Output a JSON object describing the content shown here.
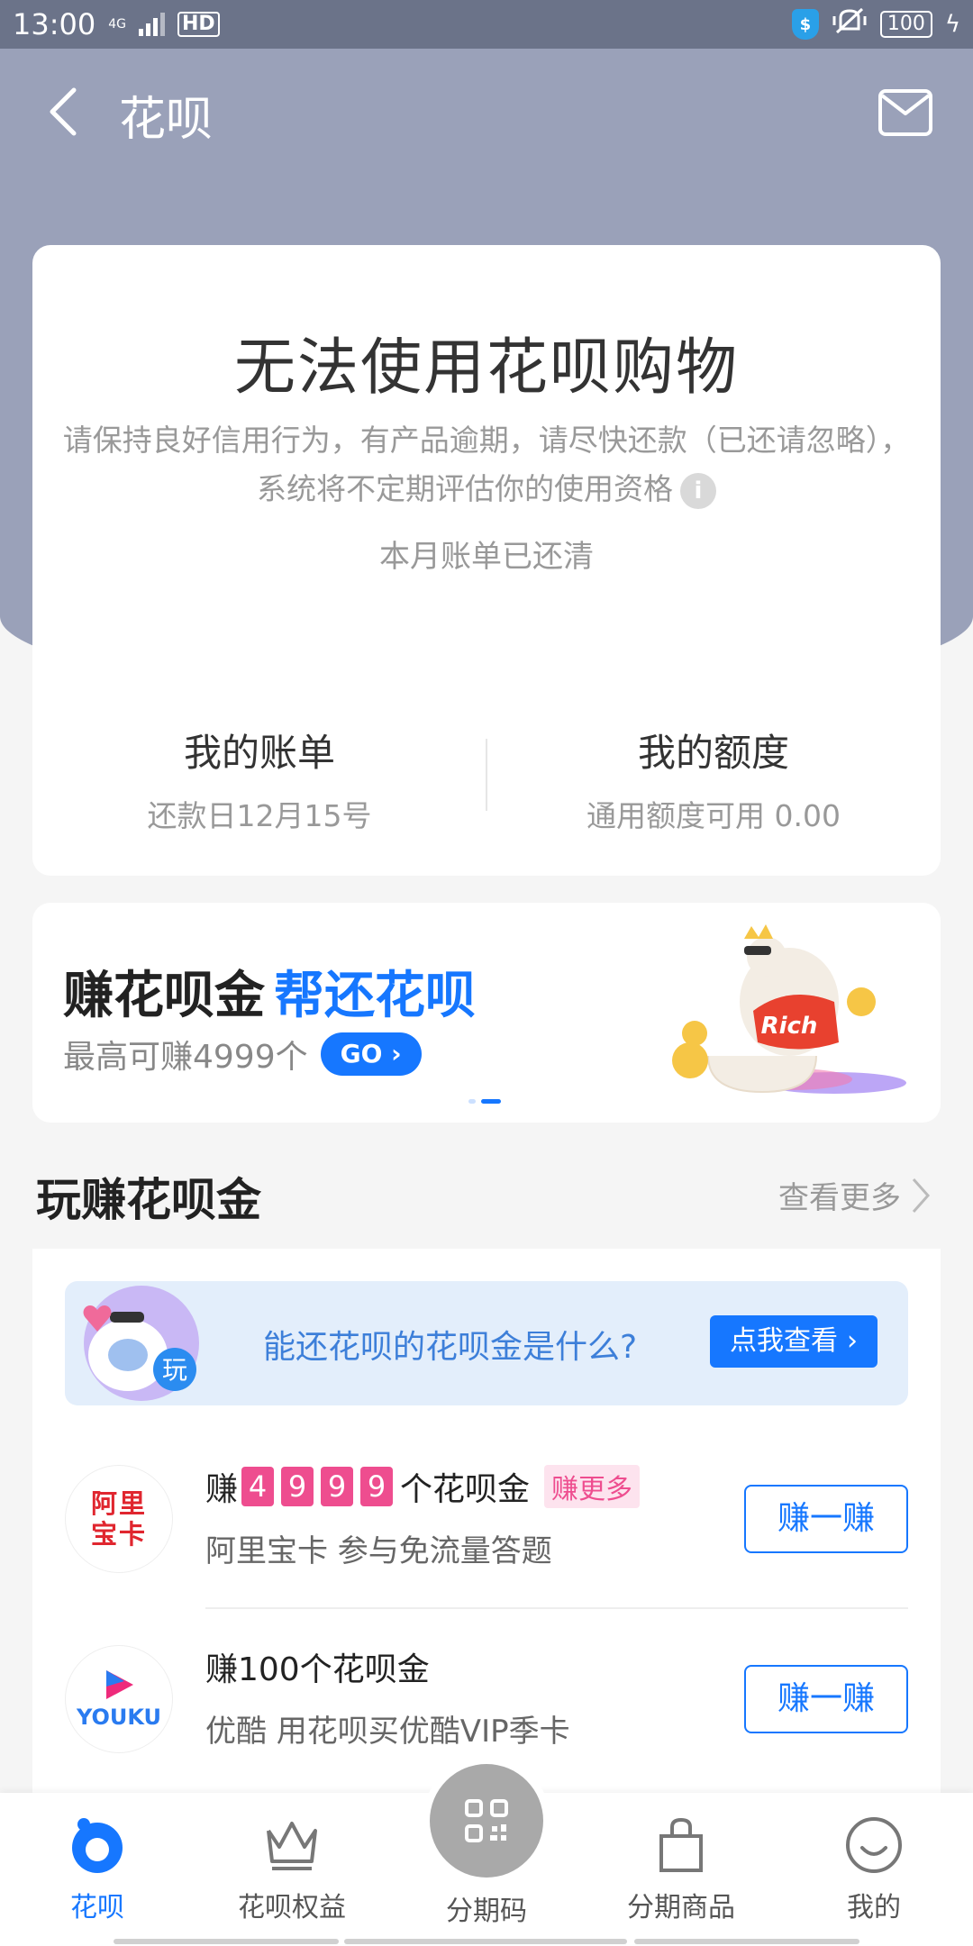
{
  "status_bar": {
    "time": "13:00",
    "network": "4G",
    "hd": "HD",
    "battery": "100"
  },
  "header": {
    "title": "花呗"
  },
  "status_card": {
    "title": "无法使用花呗购物",
    "description": "请保持良好信用行为，有产品逾期，请尽快还款（已还请忽略），系统将不定期评估你的使用资格",
    "sub": "本月账单已还清",
    "bill": {
      "title": "我的账单",
      "sub": "还款日12月15号"
    },
    "quota": {
      "title": "我的额度",
      "sub": "通用额度可用 0.00"
    }
  },
  "banner": {
    "title_black": "赚花呗金",
    "title_blue": "帮还花呗",
    "sub": "最高可赚4999个",
    "go_label": "GO",
    "badge_text": "Rich"
  },
  "section": {
    "title": "玩赚花呗金",
    "see_more": "查看更多"
  },
  "info_banner": {
    "text": "能还花呗的花呗金是什么?",
    "button": "点我查看",
    "mascot_label": "玩"
  },
  "tasks": [
    {
      "title_prefix": "赚",
      "digits": [
        "4",
        "9",
        "9",
        "9"
      ],
      "title_suffix": "个花呗金",
      "tag": "赚更多",
      "desc": "阿里宝卡 参与免流量答题",
      "logo_text": "阿里宝卡",
      "button": "赚一赚"
    },
    {
      "title": "赚100个花呗金",
      "desc": "优酷 用花呗买优酷VIP季卡",
      "logo_text": "YOUKU",
      "button": "赚一赚"
    }
  ],
  "bottom_nav": {
    "items": [
      {
        "label": "花呗",
        "icon": "huabei-icon",
        "active": true
      },
      {
        "label": "花呗权益",
        "icon": "crown-icon",
        "active": false
      },
      {
        "label": "分期码",
        "icon": "qr-code-icon",
        "active": false
      },
      {
        "label": "分期商品",
        "icon": "shopping-bag-icon",
        "active": false
      },
      {
        "label": "我的",
        "icon": "smile-icon",
        "active": false
      }
    ]
  },
  "colors": {
    "header": "#9aa1b9",
    "status_bar": "#6b7389",
    "accent": "#1677ff",
    "pink": "#ee4d8f"
  }
}
